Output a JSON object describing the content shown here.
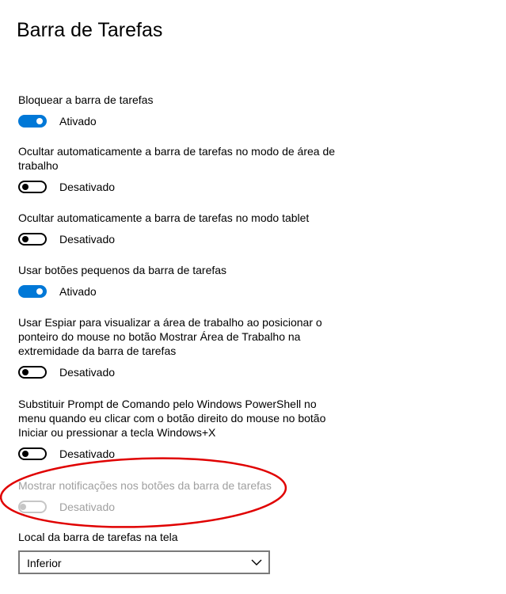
{
  "page": {
    "title": "Barra de Tarefas"
  },
  "colors": {
    "accent": "#0078d7",
    "annotation": "#e00000",
    "disabled": "#a0a0a0"
  },
  "settings": [
    {
      "label": "Bloquear a barra de tarefas",
      "state": "Ativado",
      "on": true,
      "enabled": true
    },
    {
      "label": "Ocultar automaticamente a barra de tarefas no modo de área de trabalho",
      "state": "Desativado",
      "on": false,
      "enabled": true
    },
    {
      "label": "Ocultar automaticamente a barra de tarefas no modo tablet",
      "state": "Desativado",
      "on": false,
      "enabled": true
    },
    {
      "label": "Usar botões pequenos da barra de tarefas",
      "state": "Ativado",
      "on": true,
      "enabled": true
    },
    {
      "label": "Usar Espiar para visualizar a área de trabalho ao posicionar o ponteiro do mouse no botão Mostrar Área de Trabalho na extremidade da barra de tarefas",
      "state": "Desativado",
      "on": false,
      "enabled": true
    },
    {
      "label": "Substituir Prompt de Comando pelo Windows PowerShell no menu quando eu clicar com o botão direito do mouse no botão Iniciar ou pressionar a tecla Windows+X",
      "state": "Desativado",
      "on": false,
      "enabled": true
    },
    {
      "label": "Mostrar notificações nos botões da barra de tarefas",
      "state": "Desativado",
      "on": false,
      "enabled": false
    }
  ],
  "location": {
    "label": "Local da barra de tarefas na tela",
    "selected": "Inferior",
    "icon": "chevron-down-icon"
  }
}
